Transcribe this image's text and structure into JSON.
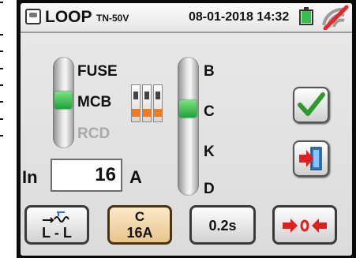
{
  "header": {
    "title": "LOOP",
    "model": "TN-50V",
    "datetime": "08-01-2018 14:32"
  },
  "protection_types": [
    {
      "label": "FUSE",
      "selected": false,
      "enabled": true
    },
    {
      "label": "MCB",
      "selected": true,
      "enabled": true
    },
    {
      "label": "RCD",
      "selected": false,
      "enabled": false
    }
  ],
  "curves": [
    {
      "label": "B",
      "selected": false
    },
    {
      "label": "C",
      "selected": true
    },
    {
      "label": "K",
      "selected": false
    },
    {
      "label": "D",
      "selected": false
    }
  ],
  "nominal_current": {
    "label": "In",
    "value": "16",
    "unit": "A"
  },
  "bottom_buttons": {
    "line_mode": "L - L",
    "curve": "C",
    "rating": "16A",
    "trip_time": "0.2s"
  },
  "icons": {
    "screen": "screen-icon",
    "battery": "battery-icon",
    "no_signal": "no-signal-icon",
    "confirm": "checkmark-icon",
    "exit": "exit-icon",
    "zero_adjust": "zero-adjust-icon",
    "line_mode": "line-to-line-icon"
  },
  "colors": {
    "selected_indicator": "#2bbf3f",
    "confirm_check": "#2e9a2e",
    "exit_red": "#e02020",
    "breaker_orange": "#f07d1c",
    "curve_button_bg": "#f3d9a8"
  }
}
